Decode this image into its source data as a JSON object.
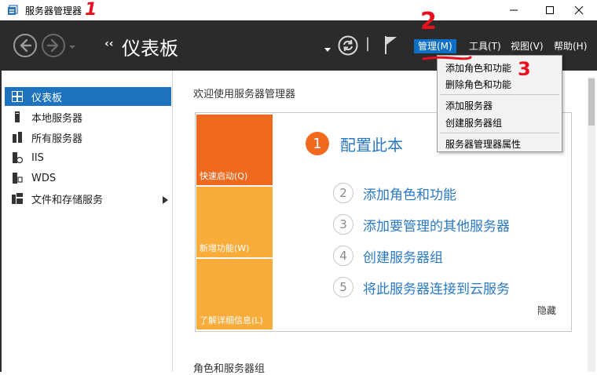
{
  "window": {
    "title": "服务器管理器",
    "controls": {
      "minimize": "—",
      "maximize": "☐",
      "close": "✕"
    }
  },
  "header": {
    "breadcrumb_arrows": "‹‹",
    "title": "仪表板",
    "refresh_separator": "|",
    "menu": {
      "manage": "管理(M)",
      "tools": "工具(T)",
      "view": "视图(V)",
      "help": "帮助(H)"
    }
  },
  "sidebar": {
    "items": [
      {
        "label": "仪表板",
        "icon": "dashboard-icon",
        "active": true
      },
      {
        "label": "本地服务器",
        "icon": "local-server-icon"
      },
      {
        "label": "所有服务器",
        "icon": "all-servers-icon"
      },
      {
        "label": "IIS",
        "icon": "iis-icon"
      },
      {
        "label": "WDS",
        "icon": "wds-icon"
      },
      {
        "label": "文件和存储服务",
        "icon": "file-storage-icon",
        "has_submenu": true
      }
    ]
  },
  "main": {
    "welcome_title": "欢迎使用服务器管理器",
    "tiles": {
      "quick_start": "快速启动(Q)",
      "whats_new": "新增功能(W)",
      "learn_more": "了解详细信息(L)"
    },
    "steps": [
      {
        "number": "1",
        "label": "配置此本",
        "primary": true
      },
      {
        "number": "2",
        "label": "添加角色和功能"
      },
      {
        "number": "3",
        "label": "添加要管理的其他服务器"
      },
      {
        "number": "4",
        "label": "创建服务器组"
      },
      {
        "number": "5",
        "label": "将此服务器连接到云服务"
      }
    ],
    "hide_link": "隐藏",
    "roles_title": "角色和服务器组"
  },
  "manage_menu": {
    "items": [
      "添加角色和功能",
      "删除角色和功能",
      "添加服务器",
      "创建服务器组",
      "服务器管理器属性"
    ]
  },
  "annotations": {
    "mark_1": "1",
    "mark_2": "2",
    "mark_3": "3",
    "color": "#e8101e"
  },
  "colors": {
    "header_bg": "#2b2b2b",
    "accent": "#1e73be",
    "tile_quick_start": "#ef6a1f",
    "tile_other": "#f9ac3a",
    "step_link": "#2a79c4"
  }
}
